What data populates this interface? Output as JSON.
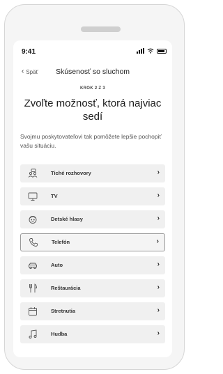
{
  "status_bar": {
    "time": "9:41"
  },
  "nav": {
    "back_label": "Späť",
    "title": "Skúsenosť so sluchom"
  },
  "step_label": "KROK 2 Z 3",
  "heading": "Zvoľte možnosť, ktorá najviac sedí",
  "description": "Svojmu poskytovateľovi tak pomôžete lepšie pochopiť vašu situáciu.",
  "options": [
    {
      "label": "Tiché rozhovory",
      "icon": "people-icon",
      "outlined": true
    },
    {
      "label": "TV",
      "icon": "tv-icon",
      "outlined": false
    },
    {
      "label": "Detské hlasy",
      "icon": "child-face-icon",
      "outlined": false
    },
    {
      "label": "Telefón",
      "icon": "phone-icon",
      "outlined": true
    },
    {
      "label": "Auto",
      "icon": "car-icon",
      "outlined": false
    },
    {
      "label": "Reštaurácia",
      "icon": "cutlery-icon",
      "outlined": false
    },
    {
      "label": "Stretnutia",
      "icon": "calendar-icon",
      "outlined": false
    },
    {
      "label": "Hudba",
      "icon": "music-note-icon",
      "outlined": false
    }
  ]
}
